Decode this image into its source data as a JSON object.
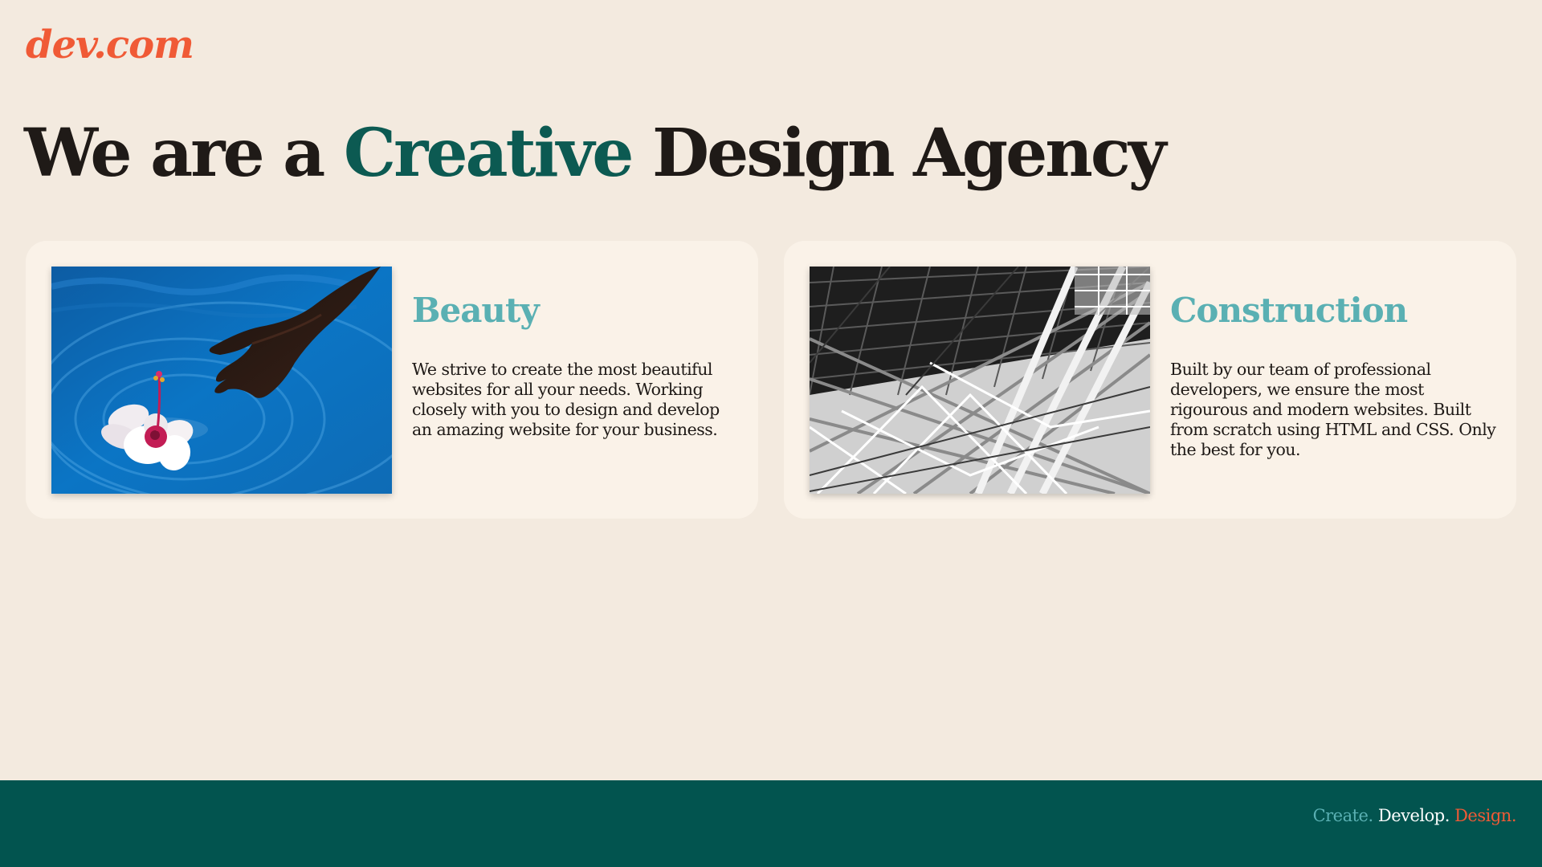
{
  "header": {
    "logo": "dev.com"
  },
  "hero": {
    "prefix": "We are a ",
    "accent": "Creative",
    "suffix": " Design Agency"
  },
  "cards": [
    {
      "title": "Beauty",
      "text": "We strive to create the most beautiful websites for all your needs. Working closely with you to design and develop an amazing website for your business.",
      "image_icon": "hand-flower-water-image"
    },
    {
      "title": "Construction",
      "text": "Built by our team of professional developers, we ensure the most rigourous and modern websites. Built from scratch using HTML and CSS. Only the best for you.",
      "image_icon": "steel-structure-image"
    }
  ],
  "footer": {
    "create": "Create.",
    "develop": "Develop.",
    "design": "Design."
  },
  "colors": {
    "background": "#f3eadf",
    "card": "#faf2e8",
    "logo": "#f05a36",
    "accent": "#0c5a52",
    "card_title": "#5ab0b3",
    "footer": "#02544f"
  }
}
